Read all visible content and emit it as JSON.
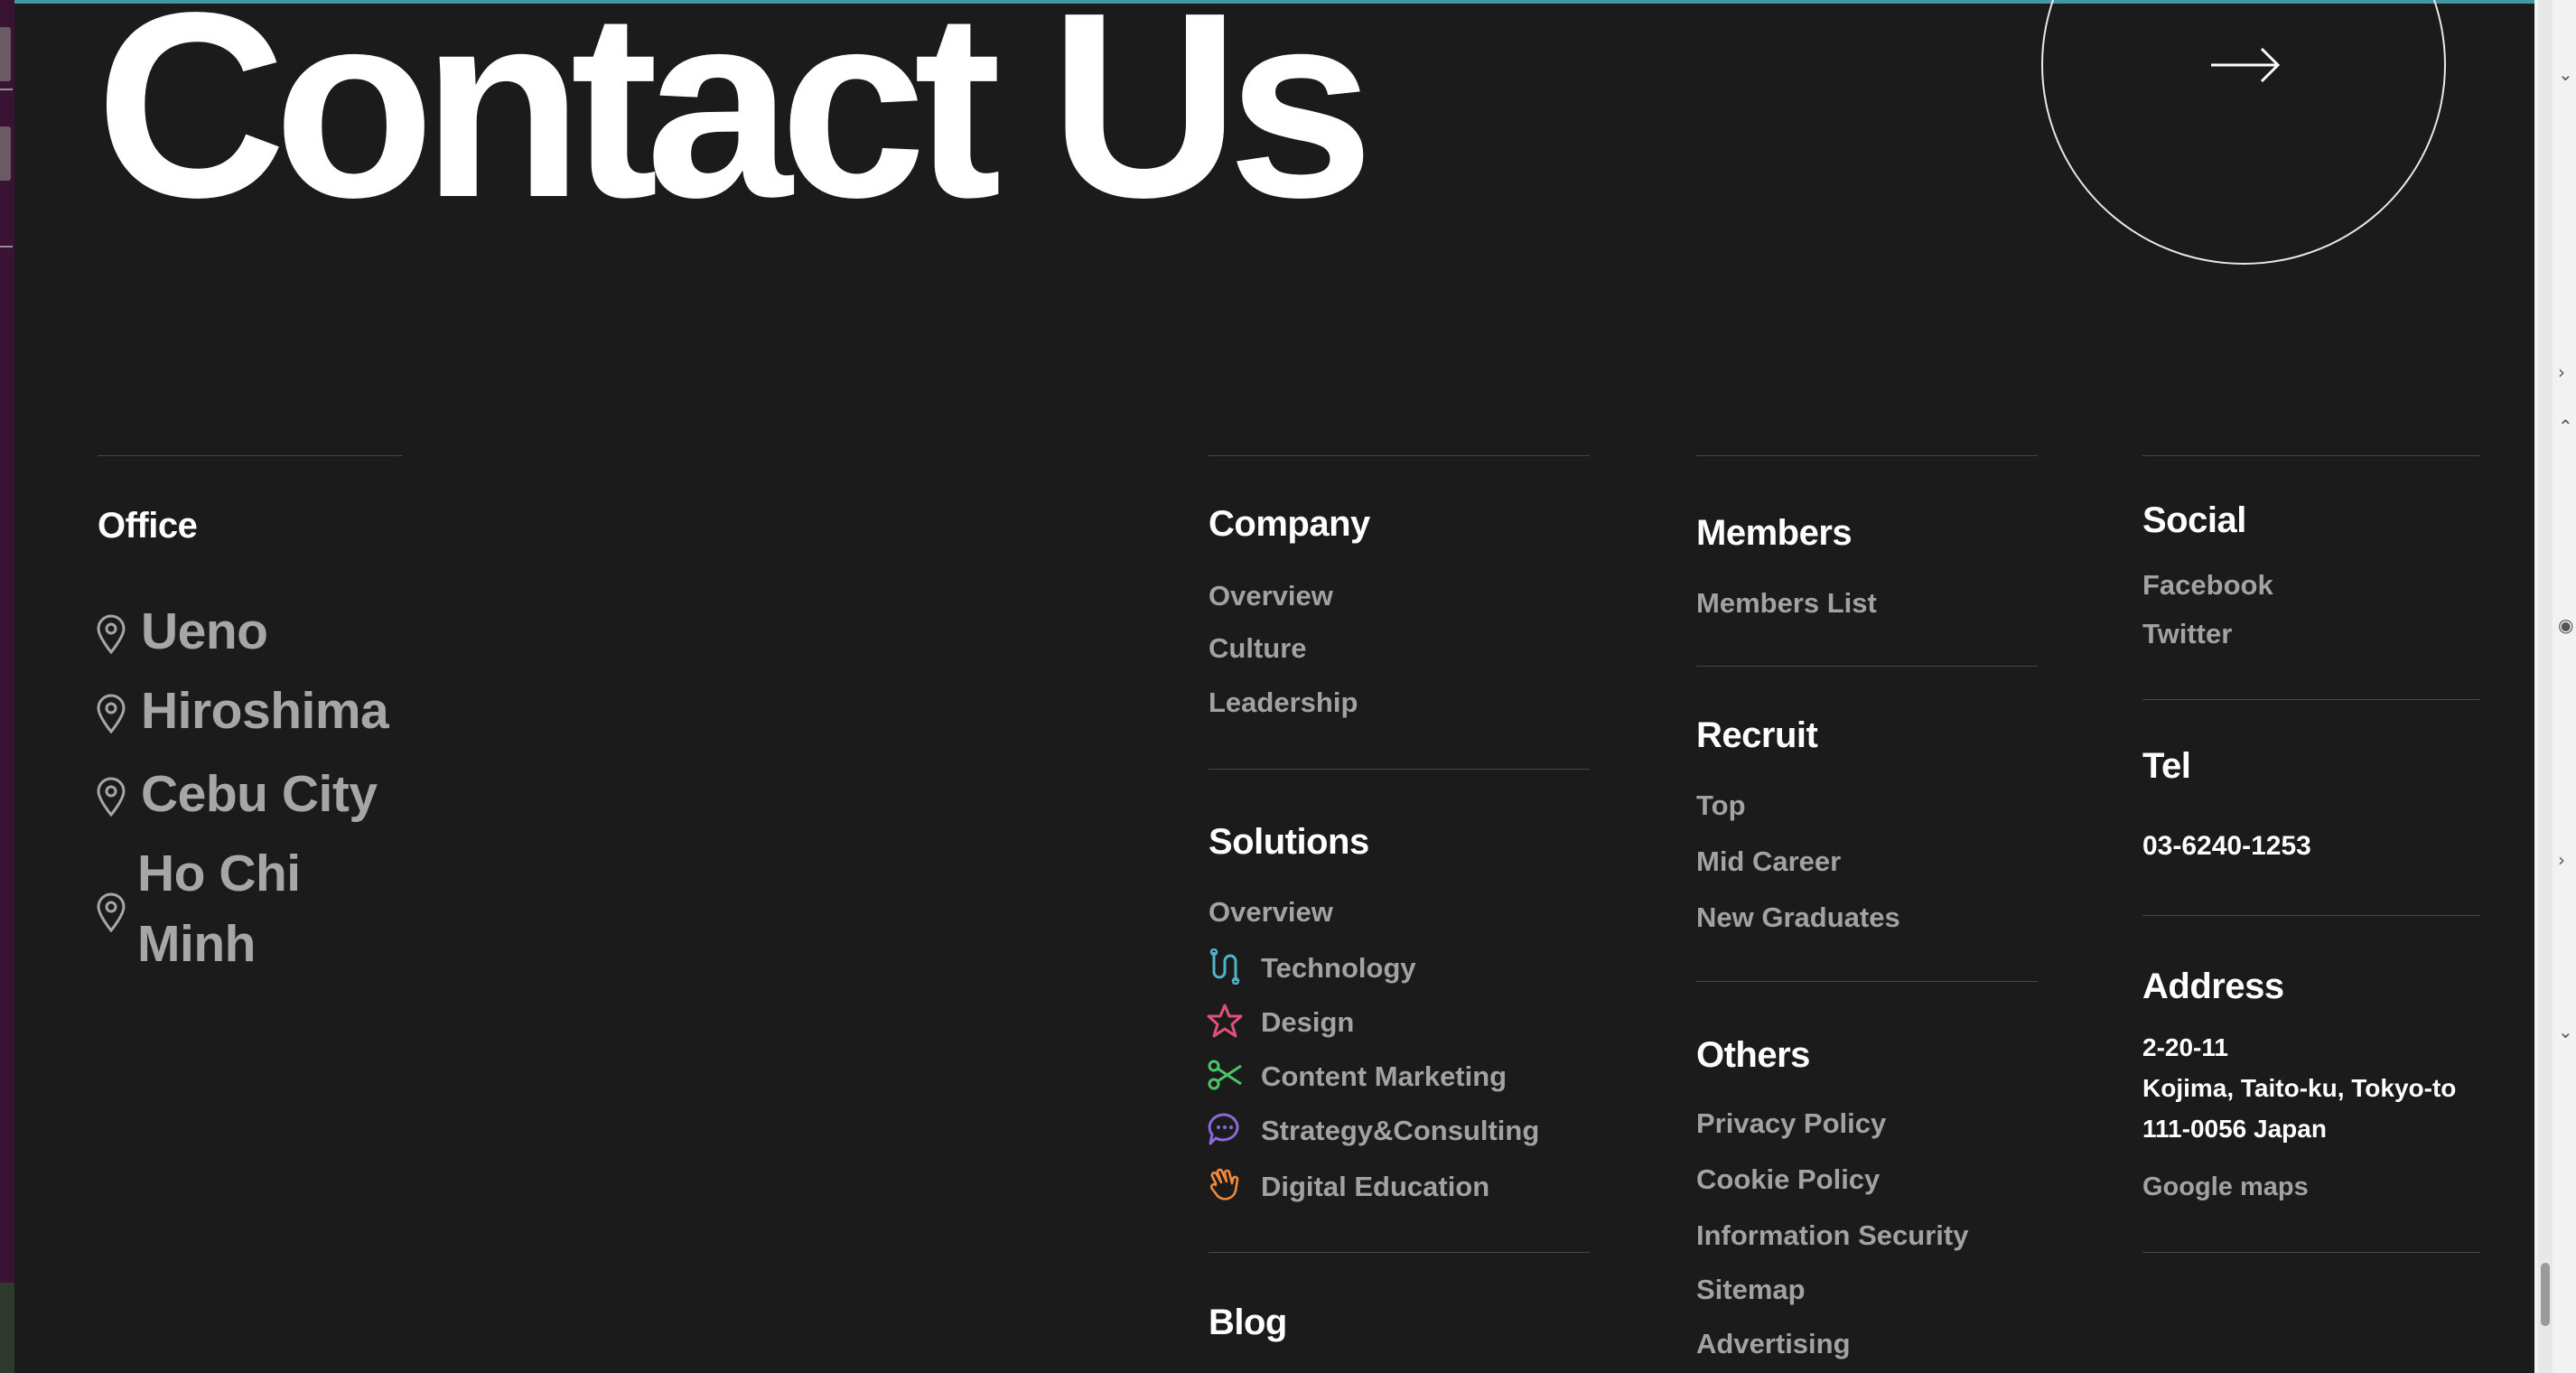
{
  "hero": {
    "title": "Contact Us"
  },
  "office": {
    "heading": "Office",
    "locations": [
      {
        "label": "Ueno",
        "icon": "map-pin-icon"
      },
      {
        "label": "Hiroshima",
        "icon": "map-pin-icon"
      },
      {
        "label": "Cebu City",
        "icon": "map-pin-icon"
      },
      {
        "label_line1": "Ho Chi",
        "label_line2": "Minh",
        "icon": "map-pin-icon"
      }
    ]
  },
  "company": {
    "heading": "Company",
    "links": [
      "Overview",
      "Culture",
      "Leadership"
    ]
  },
  "solutions": {
    "heading": "Solutions",
    "overview": "Overview",
    "items": [
      {
        "label": "Technology",
        "icon": "technology-icon",
        "color": "#4fb3c9"
      },
      {
        "label": "Design",
        "icon": "star-icon",
        "color": "#e0517a"
      },
      {
        "label": "Content Marketing",
        "icon": "scissors-icon",
        "color": "#4cc46a"
      },
      {
        "label": "Strategy&Consulting",
        "icon": "chat-bubbles-icon",
        "color": "#8a6ad8"
      },
      {
        "label": "Digital Education",
        "icon": "waving-hand-icon",
        "color": "#f08a3a"
      }
    ]
  },
  "blog": {
    "heading": "Blog"
  },
  "members": {
    "heading": "Members",
    "links": [
      "Members List"
    ]
  },
  "recruit": {
    "heading": "Recruit",
    "links": [
      "Top",
      "Mid Career",
      "New Graduates"
    ]
  },
  "others": {
    "heading": "Others",
    "links": [
      "Privacy Policy",
      "Cookie Policy",
      "Information Security",
      "Sitemap",
      "Advertising"
    ]
  },
  "social": {
    "heading": "Social",
    "links": [
      "Facebook",
      "Twitter"
    ]
  },
  "tel": {
    "heading": "Tel",
    "number": "03-6240-1253"
  },
  "address": {
    "heading": "Address",
    "line1": "2-20-11",
    "line2": "Kojima, Taito-ku, Tokyo-to",
    "line3": "111-0056 Japan",
    "map_link": "Google maps"
  },
  "colors": {
    "background": "#1b1b1b",
    "muted_link": "#a2a2a2",
    "accent_line": "#3f9aa6"
  }
}
